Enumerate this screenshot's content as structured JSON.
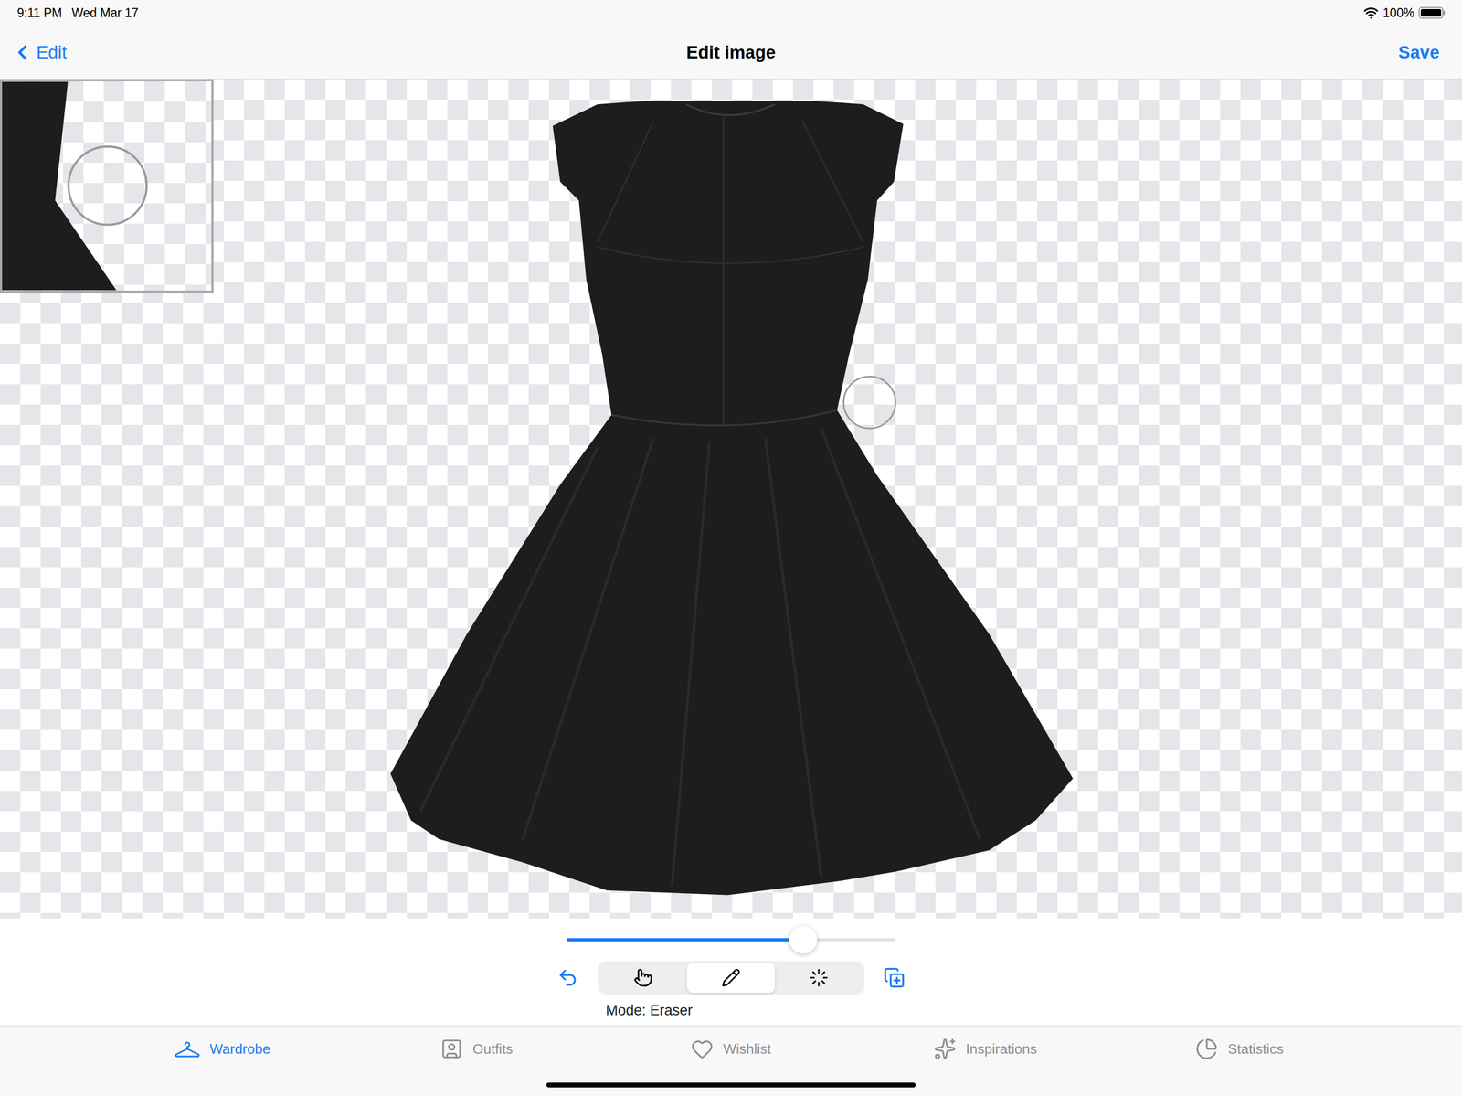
{
  "status_bar": {
    "time": "9:11 PM",
    "date": "Wed Mar 17",
    "battery": "100%",
    "battery_level": 1
  },
  "nav": {
    "back": "Edit",
    "title": "Edit image",
    "action": "Save"
  },
  "brush_size": {
    "level": 0.72
  },
  "tools": [
    {
      "kind": "move",
      "selected": false
    },
    {
      "kind": "eraser",
      "selected": true
    },
    {
      "kind": "magic",
      "selected": false
    }
  ],
  "mode_label": "Mode: Eraser",
  "tabs": [
    {
      "label": "Wardrobe",
      "selected": true
    },
    {
      "label": "Outfits",
      "selected": false
    },
    {
      "label": "Wishlist",
      "selected": false
    },
    {
      "label": "Inspirations",
      "selected": false
    },
    {
      "label": "Statistics",
      "selected": false
    }
  ]
}
